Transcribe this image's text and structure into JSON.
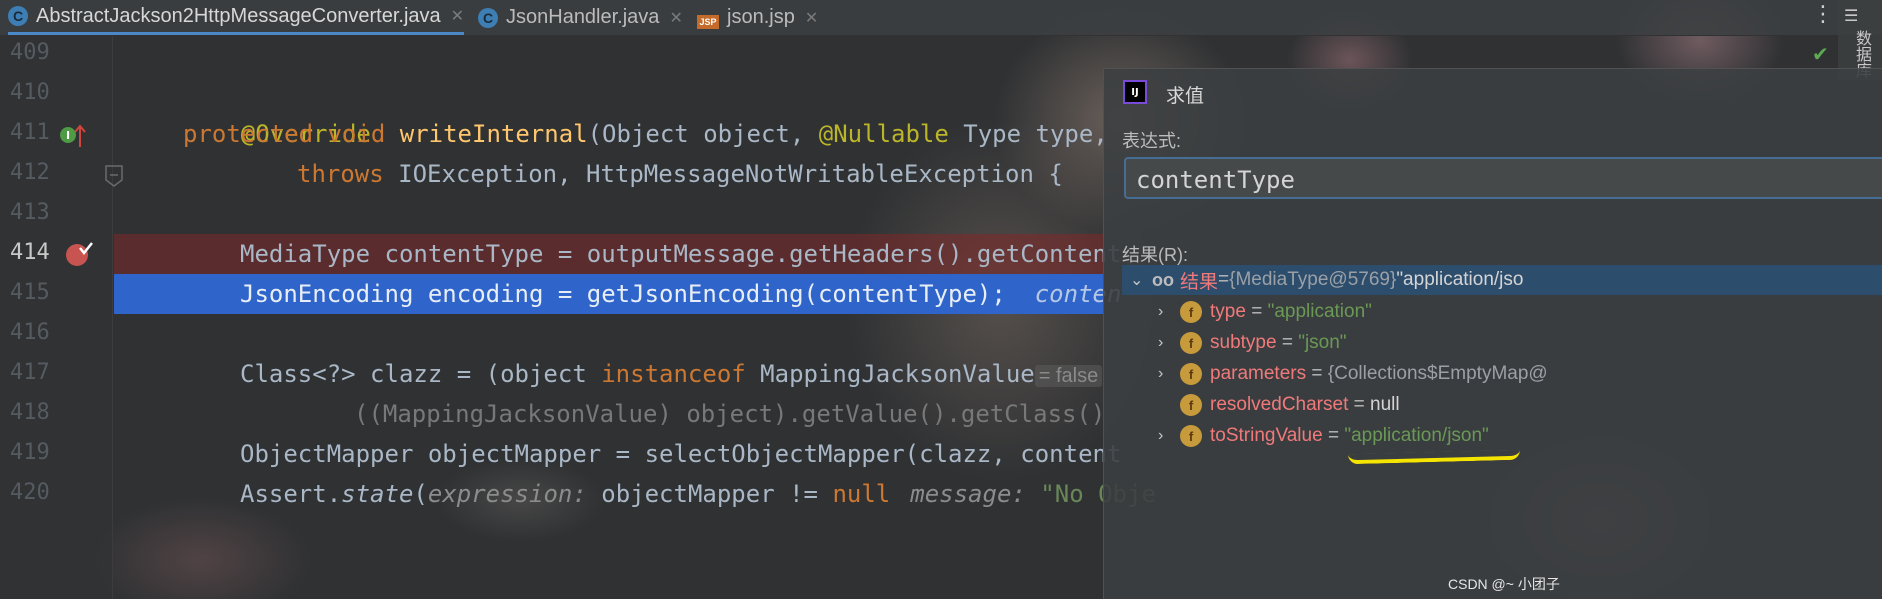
{
  "tabs": [
    {
      "label": "AbstractJackson2HttpMessageConverter.java",
      "icon": "java-class-icon",
      "active": true
    },
    {
      "label": "JsonHandler.java",
      "icon": "java-class-icon",
      "active": false
    },
    {
      "label": "json.jsp",
      "icon": "jsp-file-icon",
      "active": false
    }
  ],
  "tab_close_glyph": "✕",
  "side_panel": {
    "label": "数据库"
  },
  "editor": {
    "line_numbers": [
      "409",
      "410",
      "411",
      "412",
      "413",
      "414",
      "415",
      "416",
      "417",
      "418",
      "419",
      "420"
    ],
    "current_line": "414",
    "lines": {
      "l410_annotation": "@Override",
      "l411_mod1": "protected",
      "l411_mod2": "void",
      "l411_method": "writeInternal",
      "l411_params_a": "(Object object, ",
      "l411_nullable": "@Nullable",
      "l411_params_b": " Type type,",
      "l412_throws": "throws",
      "l412_rest": " IOException, HttpMessageNotWritableException {",
      "l414": "MediaType contentType = outputMessage.getHeaders().getContent",
      "l415_code": "JsonEncoding encoding = getJsonEncoding(contentType);",
      "l415_hint": "conten",
      "l417_a": "Class<?> clazz = (object ",
      "l417_kw": "instanceof",
      "l417_b": " MappingJacksonValue",
      "l417_hint": "= false",
      "l418": "((MappingJacksonValue) object).getValue().getClass()",
      "l419_a": "ObjectMapper objectMapper = selectObjectMapper(clazz, ",
      "l419_b": "content",
      "l420_a": "Assert.",
      "l420_state": "state",
      "l420_b": "(",
      "l420_hint1": "expression:",
      "l420_c": " objectMapper != ",
      "l420_null": "null",
      "l420_hint2": "message:",
      "l420_d": " \"No Obje"
    }
  },
  "evaluate": {
    "title": "求值",
    "expression_label": "表达式:",
    "expression_value": "contentType",
    "result_label": "结果(R):",
    "root": {
      "name": "结果",
      "eq": " = ",
      "obj": "{MediaType@5769}",
      "str": " \"application/jso"
    },
    "fields": [
      {
        "name": "type",
        "value": "\"application\""
      },
      {
        "name": "subtype",
        "value": "\"json\""
      },
      {
        "name": "parameters",
        "value": "{Collections$EmptyMap@"
      },
      {
        "name": "resolvedCharset",
        "value": "null"
      },
      {
        "name": "toStringValue",
        "value": "\"application/json\""
      }
    ]
  },
  "watermark": "CSDN @~ 小团子",
  "colors": {
    "accent": "#2f65ca",
    "breakpoint": "#c75450",
    "highlight_underline": "#f5e400"
  }
}
